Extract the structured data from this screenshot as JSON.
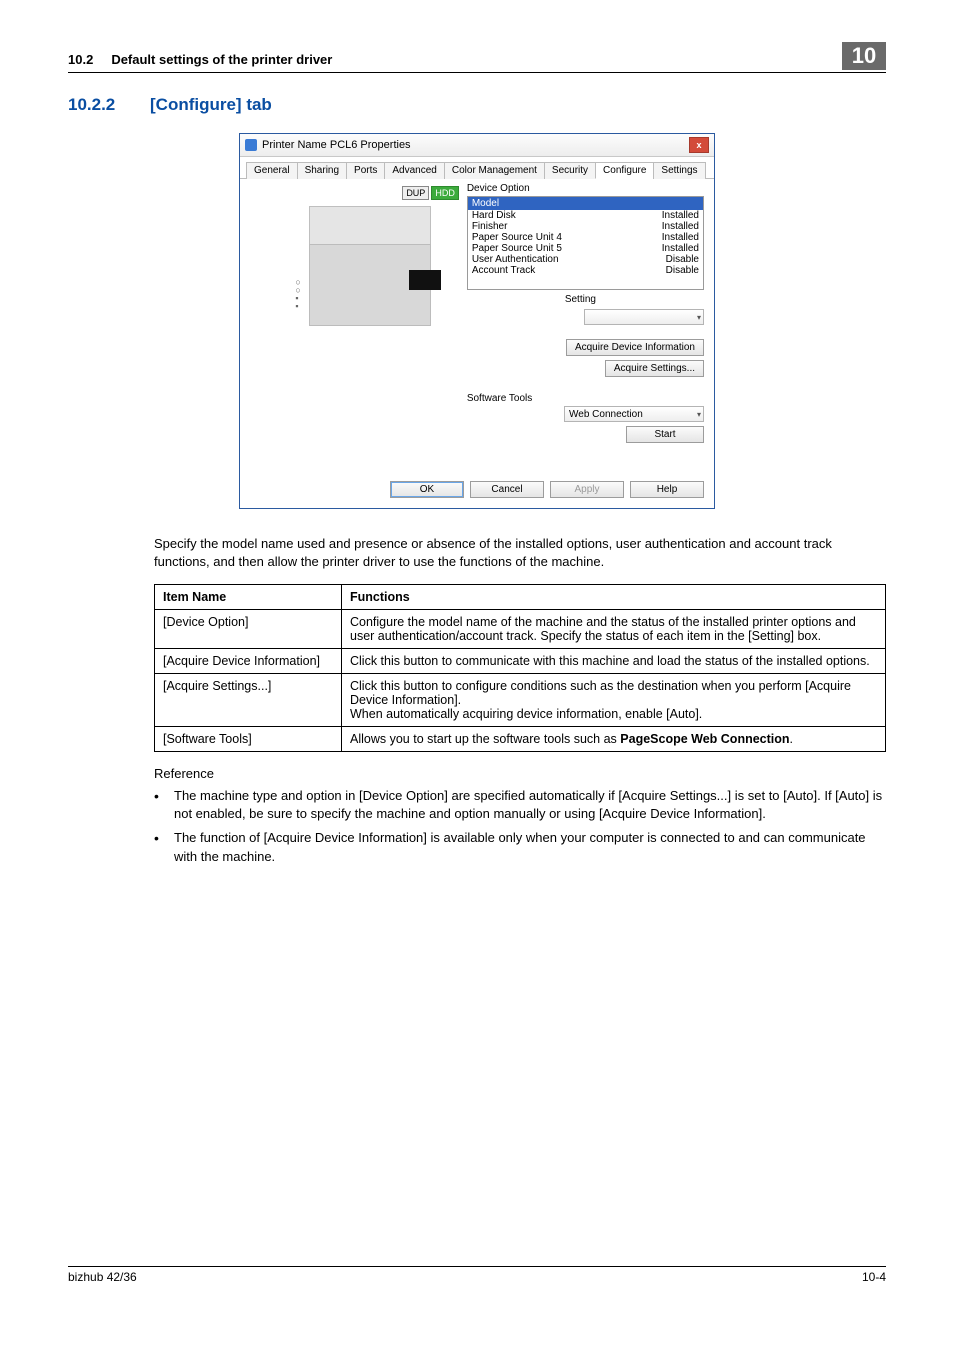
{
  "header": {
    "section_num": "10.2",
    "section_title": "Default settings of the printer driver",
    "chapter_badge": "10"
  },
  "heading": {
    "num": "10.2.2",
    "name": "[Configure] tab"
  },
  "dialog": {
    "title": "Printer Name PCL6 Properties",
    "close_glyph": "x",
    "tabs": [
      "General",
      "Sharing",
      "Ports",
      "Advanced",
      "Color Management",
      "Security",
      "Configure",
      "Settings"
    ],
    "active_tab_index": 6,
    "badges": {
      "dup": "DUP",
      "hdd": "HDD"
    },
    "group_label": "Device Option",
    "list_header": {
      "name": "Model",
      "value": ""
    },
    "options": [
      {
        "name": "Hard Disk",
        "value": "Installed"
      },
      {
        "name": "Finisher",
        "value": "Installed"
      },
      {
        "name": "Paper Source Unit 4",
        "value": "Installed"
      },
      {
        "name": "Paper Source Unit 5",
        "value": "Installed"
      },
      {
        "name": "User Authentication",
        "value": "Disable"
      },
      {
        "name": "Account Track",
        "value": "Disable"
      }
    ],
    "setting_label": "Setting",
    "acquire_info_btn": "Acquire Device Information",
    "acquire_settings_btn": "Acquire Settings...",
    "tools_label": "Software Tools",
    "tools_select": "Web Connection",
    "start_btn": "Start",
    "footer_buttons": {
      "ok": "OK",
      "cancel": "Cancel",
      "apply": "Apply",
      "help": "Help"
    }
  },
  "intro_text": "Specify the model name used and presence or absence of the installed options, user authentication and account track functions, and then allow the printer driver to use the functions of the machine.",
  "table": {
    "head": {
      "c1": "Item Name",
      "c2": "Functions"
    },
    "rows": [
      {
        "c1": "[Device Option]",
        "c2": "Configure the model name of the machine and the status of the installed printer options and user authentication/account track. Specify the status of each item in the [Setting] box."
      },
      {
        "c1": "[Acquire Device Information]",
        "c2": "Click this button to communicate with this machine and load the status of the installed options."
      },
      {
        "c1": "[Acquire Settings...]",
        "c2": "Click this button to configure conditions such as the destination when you perform [Acquire Device Information].\nWhen automatically acquiring device information, enable [Auto]."
      },
      {
        "c1": "[Software Tools]",
        "c2_pre": "Allows you to start up the software tools such as ",
        "c2_bold": "PageScope Web Connection",
        "c2_post": "."
      }
    ]
  },
  "reference": {
    "label": "Reference",
    "items": [
      "The machine type and option in [Device Option] are specified automatically if [Acquire Settings...] is set to [Auto]. If [Auto] is not enabled, be sure to specify the machine and option manually or using [Acquire Device Information].",
      "The function of [Acquire Device Information] is available only when your computer is connected to and can communicate with the machine."
    ]
  },
  "footer": {
    "left": "bizhub 42/36",
    "right": "10-4"
  }
}
